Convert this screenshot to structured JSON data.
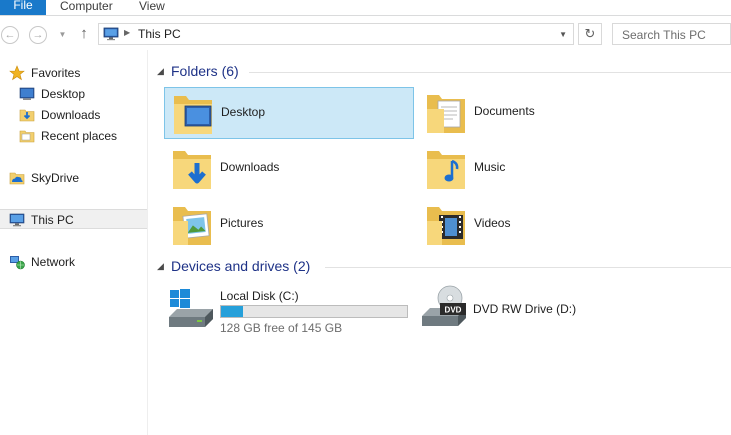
{
  "ribbon": {
    "tabs": [
      "File",
      "Computer",
      "View"
    ]
  },
  "address": {
    "path": "This PC",
    "search_placeholder": "Search This PC"
  },
  "navpane": {
    "items": [
      {
        "label": "Favorites",
        "icon": "star-icon"
      },
      {
        "label": "Desktop",
        "icon": "desktop-icon"
      },
      {
        "label": "Downloads",
        "icon": "downloads-folder-icon"
      },
      {
        "label": "Recent places",
        "icon": "recent-places-icon"
      },
      {
        "label": "SkyDrive",
        "icon": "skydrive-icon"
      },
      {
        "label": "This PC",
        "icon": "this-pc-icon"
      },
      {
        "label": "Network",
        "icon": "network-icon"
      }
    ]
  },
  "folders": {
    "header": "Folders (6)",
    "items": [
      {
        "label": "Desktop"
      },
      {
        "label": "Documents"
      },
      {
        "label": "Downloads"
      },
      {
        "label": "Music"
      },
      {
        "label": "Pictures"
      },
      {
        "label": "Videos"
      }
    ]
  },
  "drives": {
    "header": "Devices and drives (2)",
    "items": [
      {
        "name": "Local Disk (C:)",
        "free_text": "128 GB free of 145 GB",
        "used_fraction": 0.117
      },
      {
        "name": "DVD RW Drive (D:)"
      }
    ]
  },
  "colors": {
    "accent": "#1979ca",
    "selection_bg": "#cce8f7",
    "selection_border": "#7dc4e8",
    "group_header": "#1e3287",
    "progress": "#26a0da"
  }
}
